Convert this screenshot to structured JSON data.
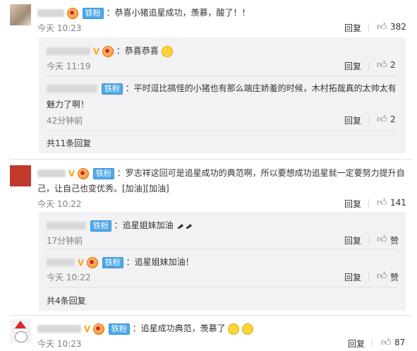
{
  "reply_label": "回复",
  "like_label": "赞",
  "fan_label": "铁粉",
  "comments": [
    {
      "text": "：恭喜小猪追星成功，羡慕，酸了！！",
      "time": "今天 10:23",
      "likes": "382",
      "replies": [
        {
          "text": "：恭喜恭喜",
          "time": "今天 11:19",
          "likes": "2"
        },
        {
          "text": "：平时逗比搞怪的小猪也有那么端庄娇羞的时候，木村拓哉真的太帅太有",
          "text2": "魅力了啊！",
          "time": "42分钟前",
          "likes": "2"
        }
      ],
      "more": "共11条回复"
    },
    {
      "text": "：罗志祥这回可是追星成功的典范啊，所以要想成功追星就一定要努力提升自",
      "text2": "己，让自己也变优秀。[加油][加油]",
      "time": "今天 10:22",
      "likes": "141",
      "replies": [
        {
          "text": "：追星姐妹加油",
          "time": "17分钟前"
        },
        {
          "text": "：追星姐妹加油！",
          "time": "今天 10:22"
        }
      ],
      "more": "共4条回复"
    },
    {
      "text": "：追星成功典范，羡慕了",
      "time": "今天 10:23",
      "likes": "87"
    }
  ],
  "icons": {
    "like": "thumbs-up-icon",
    "vip": "v-badge-icon",
    "medal": "fan-medal-icon"
  },
  "colors": {
    "fan_badge": "#4fa8e8",
    "vip_badge": "#f5a623",
    "sub_bg": "#f2f2f5"
  }
}
